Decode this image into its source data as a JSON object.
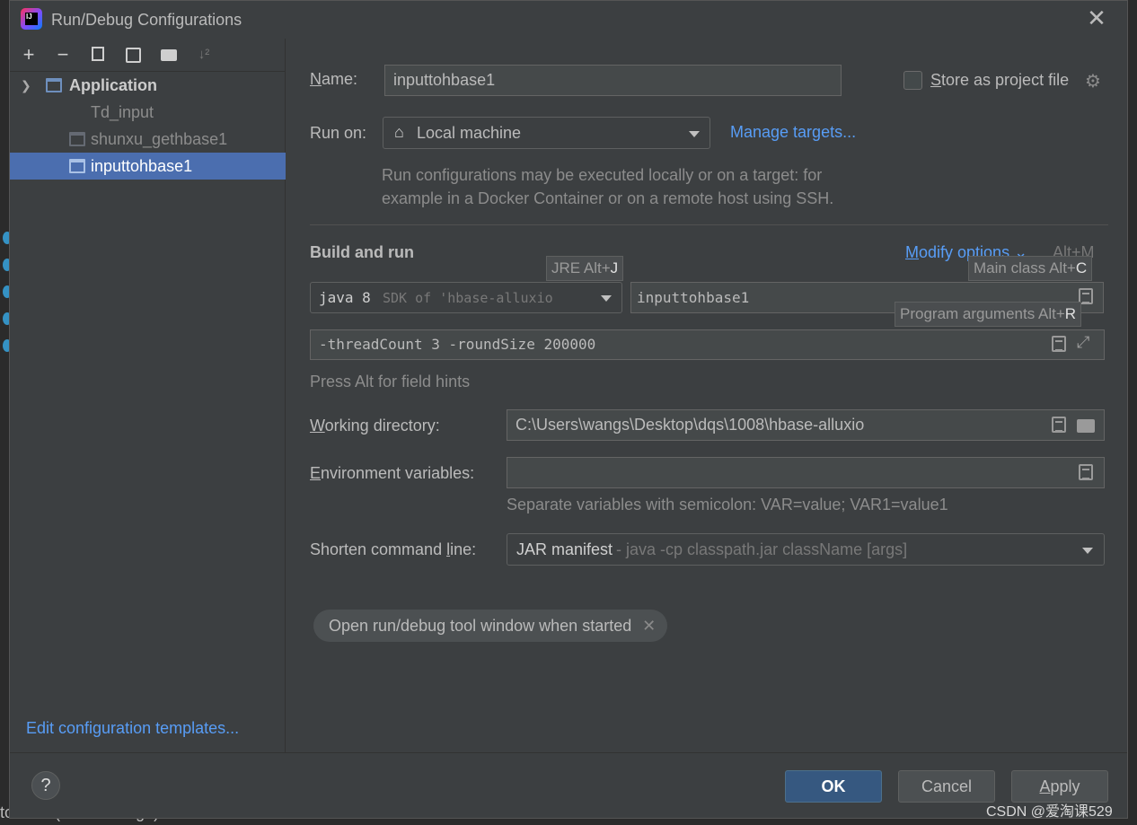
{
  "dialog": {
    "title": "Run/Debug Configurations",
    "app_icon_text": "IJ"
  },
  "toolbar": {
    "add": "+",
    "remove": "−",
    "copy": "⧉",
    "save": "🖫",
    "folder": "📁",
    "sort": "↓²"
  },
  "tree": {
    "group_label": "Application",
    "items": [
      {
        "label": "Td_input"
      },
      {
        "label": "shunxu_gethbase1"
      },
      {
        "label": "inputtohbase1"
      }
    ]
  },
  "edit_templates_link": "Edit configuration templates...",
  "form": {
    "name_label": "Name:",
    "name_value": "inputtohbase1",
    "store_as_project_file": "Store as project file",
    "run_on_label": "Run on:",
    "run_on_value": "Local machine",
    "manage_targets": "Manage targets...",
    "run_on_hint": [
      "Run configurations may be executed locally or on a target: for",
      "example in a Docker Container or on a remote host using SSH."
    ],
    "build_and_run_title": "Build and run",
    "modify_options": "Modify options",
    "modify_options_shortcut": "Alt+M",
    "jre_tooltip": "JRE Alt+",
    "jre_tooltip_key": "J",
    "main_class_tooltip": "Main class Alt+",
    "main_class_tooltip_key": "C",
    "program_args_tooltip": "Program arguments Alt+",
    "program_args_tooltip_key": "R",
    "sdk_value_java": "java 8",
    "sdk_value_rest": " SDK of 'hbase-alluxio",
    "main_class_value": "inputtohbase1",
    "program_args_value": "-threadCount 3 -roundSize 200000",
    "press_alt_hint": "Press Alt for field hints",
    "working_dir_label": "Working directory:",
    "working_dir_value": "C:\\Users\\wangs\\Desktop\\dqs\\1008\\hbase-alluxio",
    "env_vars_label": "Environment variables:",
    "env_vars_value": "",
    "env_vars_hint": "Separate variables with semicolon: VAR=value; VAR1=value1",
    "shorten_label": "Shorten command line:",
    "shorten_value": "JAR manifest",
    "shorten_detail": " - java -cp classpath.jar className [args]",
    "chip_label": "Open run/debug tool window when started"
  },
  "buttons": {
    "help": "?",
    "ok": "OK",
    "cancel": "Cancel",
    "apply": "Apply"
  },
  "watermark": "CSDN @爱淘课529",
  "background": {
    "bottom_text": "to-date (a minute ago)"
  },
  "colors": {
    "accent": "#4b6eaf",
    "link": "#589df6",
    "ok_button": "#365880"
  }
}
